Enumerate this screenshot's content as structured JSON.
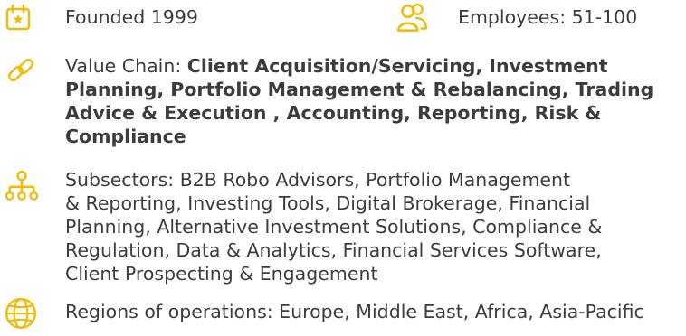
{
  "accent_color": "#f5b800",
  "facts": {
    "founded": {
      "icon": "calendar-star-icon",
      "text": "Founded 1999"
    },
    "employees": {
      "icon": "people-icon",
      "text": "Employees: 51-100"
    },
    "value_chain": {
      "icon": "link-icon",
      "label": "Value Chain: ",
      "lines": [
        "Client Acquisition/Servicing, Investment",
        "Planning, Portfolio Management & Rebalancing, Trading",
        "Advice & Execution , Accounting, Reporting, Risk &",
        "Compliance"
      ]
    },
    "subsectors": {
      "icon": "hierarchy-icon",
      "lines": [
        "Subsectors: B2B Robo Advisors, Portfolio Management",
        "& Reporting, Investing Tools, Digital Brokerage, Financial",
        "Planning, Alternative Investment Solutions, Compliance &",
        "Regulation, Data & Analytics, Financial Services Software,",
        "Client Prospecting & Engagement"
      ]
    },
    "regions": {
      "icon": "globe-icon",
      "text": "Regions of operations: Europe, Middle East, Africa, Asia-Pacific"
    }
  }
}
